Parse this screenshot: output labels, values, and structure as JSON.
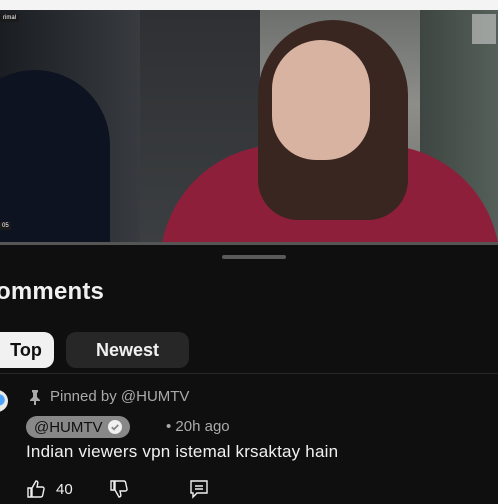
{
  "video": {
    "corner_label_top": "rimal",
    "corner_label_bottom": "05"
  },
  "comments": {
    "title": "omments",
    "sort_chips": {
      "top_label": "Top",
      "newest_label": "Newest"
    },
    "pinned_comment": {
      "pinned_text": "Pinned by @HUMTV",
      "author": "@HUMTV",
      "time": "• 20h ago",
      "text": "Indian viewers vpn istemal krsaktay hain",
      "likes": "40"
    }
  },
  "colors": {
    "background": "#0f0f0f",
    "chip_selected": "#f1f1f1",
    "chip_unselected": "#272727",
    "muted_text": "#aaaaaa",
    "hoodie": "#8e1f3b"
  },
  "icons": {
    "pin": "pin-icon",
    "verified": "verified-check-icon",
    "like": "thumbs-up-icon",
    "dislike": "thumbs-down-icon",
    "reply": "reply-comment-icon"
  }
}
